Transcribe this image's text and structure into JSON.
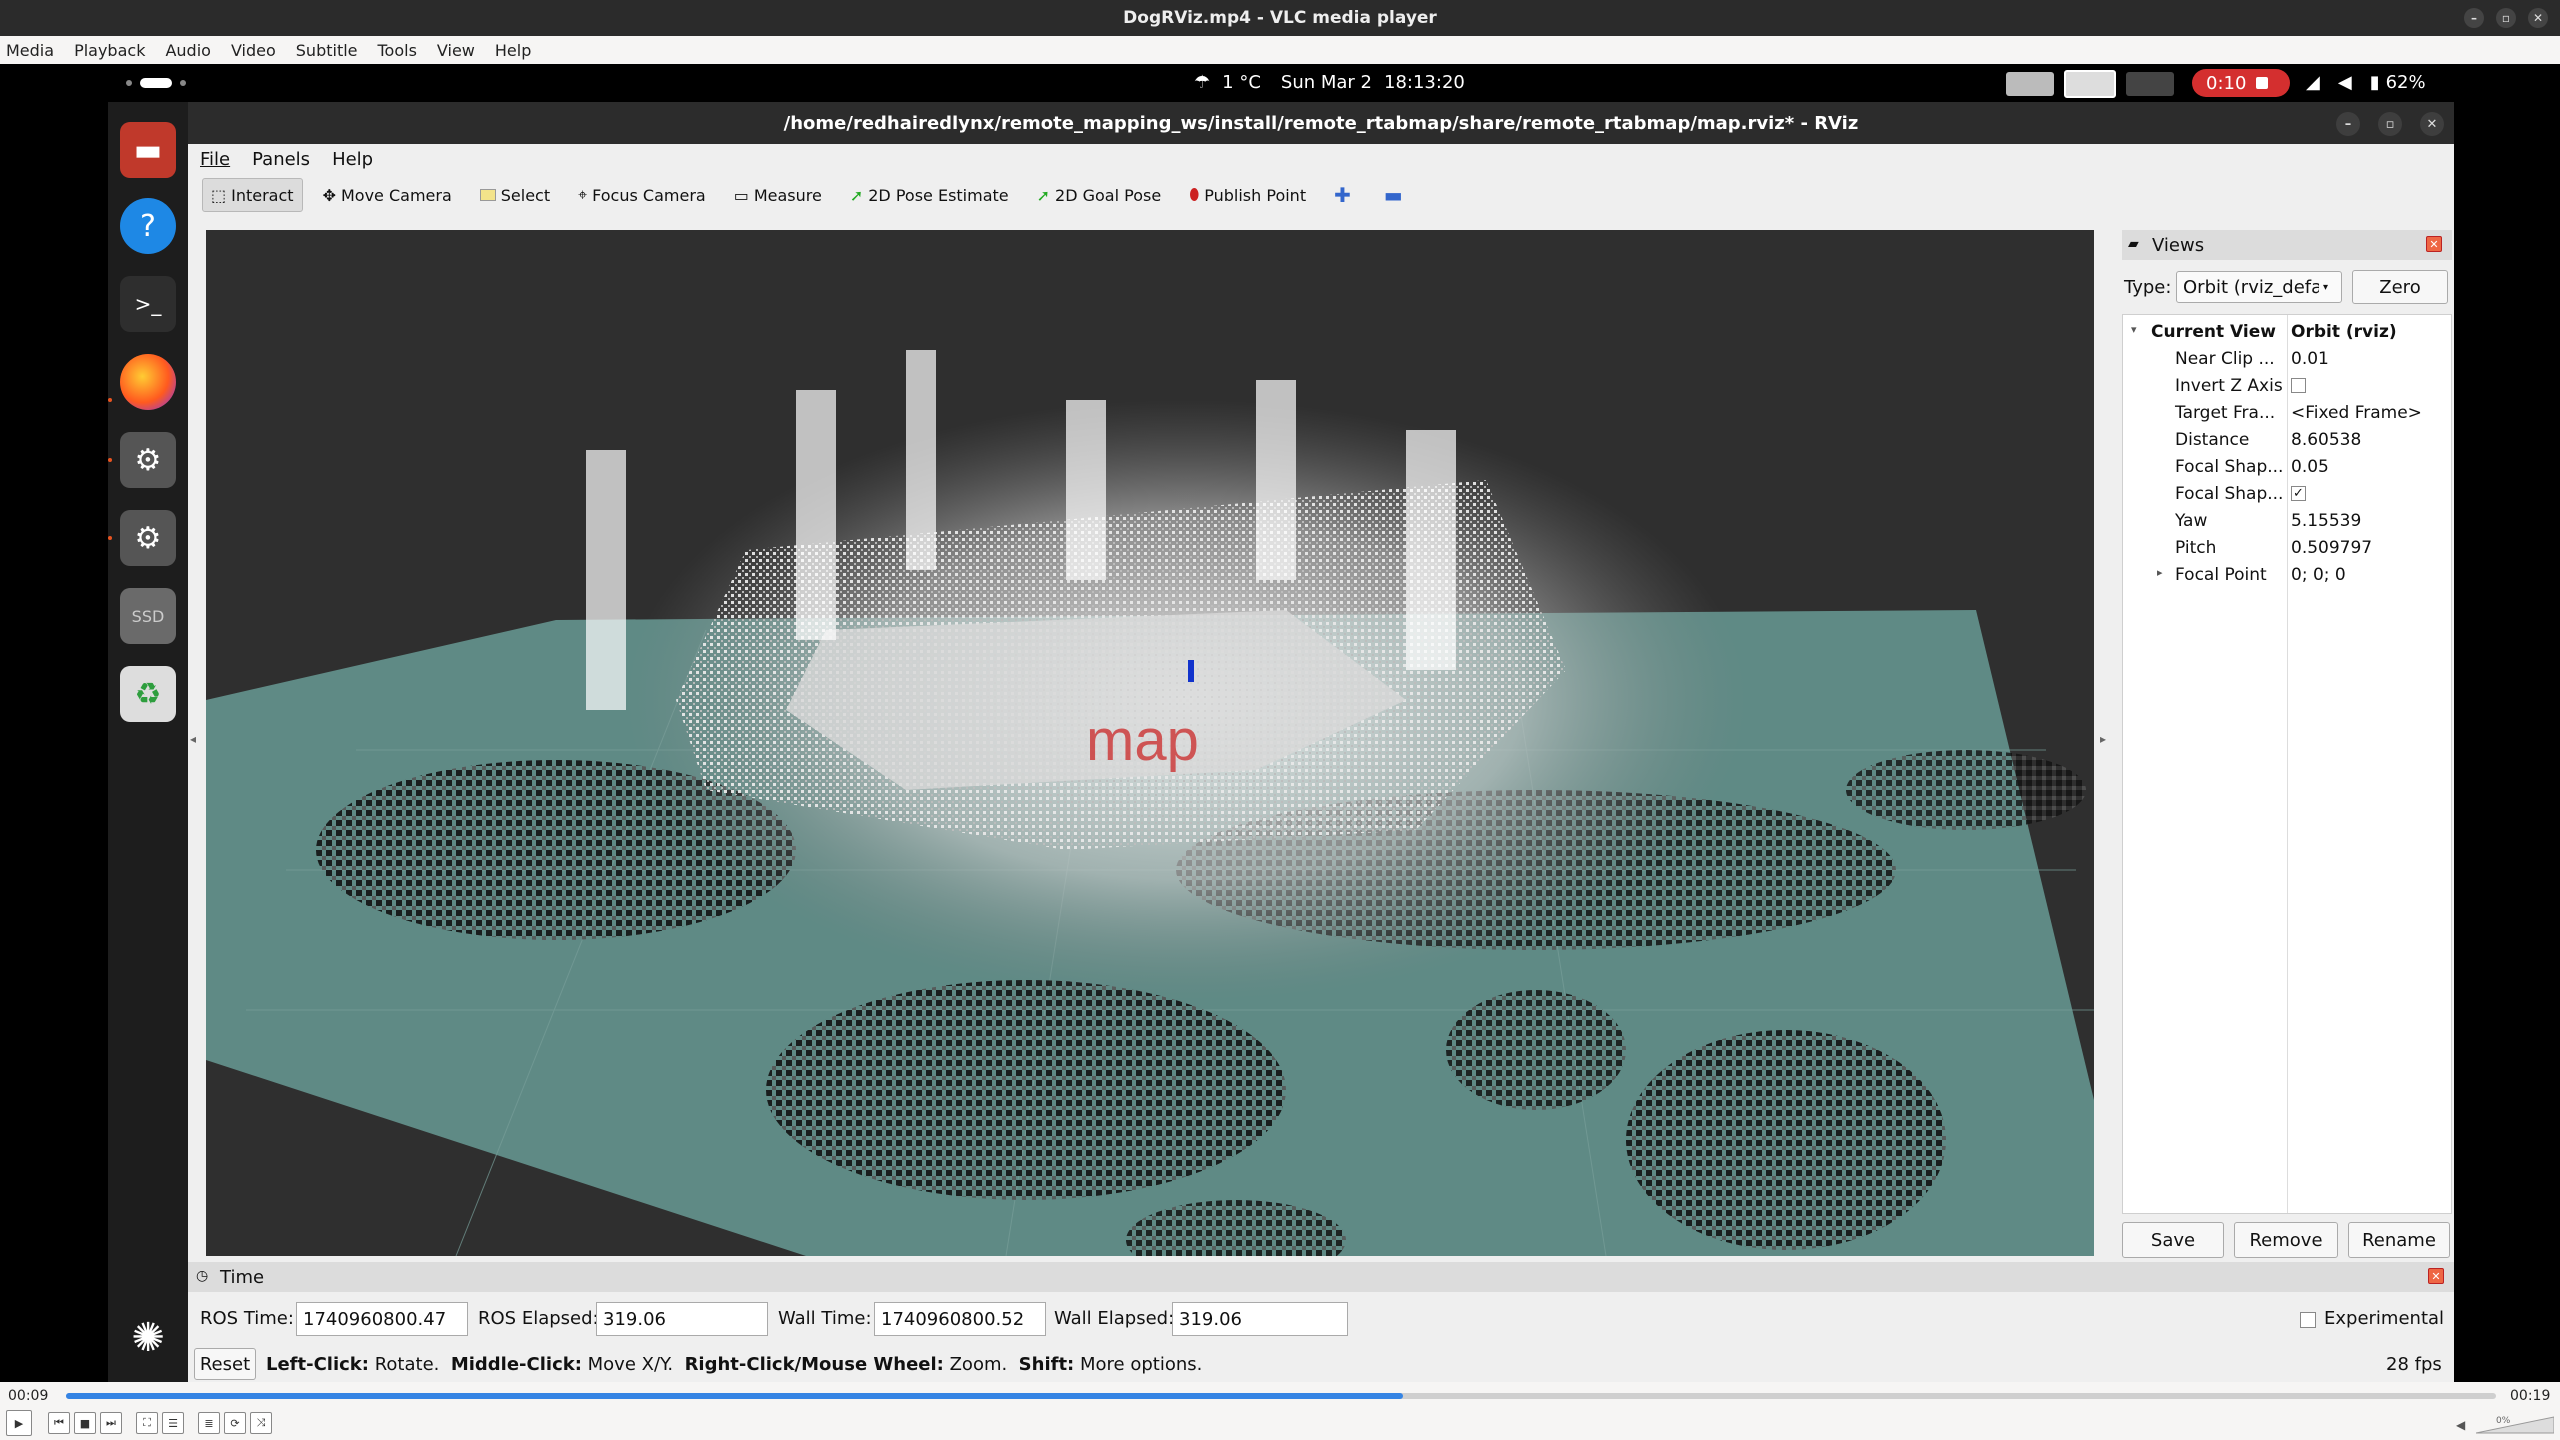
{
  "vlc": {
    "title": "DogRViz.mp4 - VLC media player",
    "menu": [
      "Media",
      "Playback",
      "Audio",
      "Video",
      "Subtitle",
      "Tools",
      "View",
      "Help"
    ],
    "time_elapsed": "00:09",
    "time_total": "00:19",
    "progress_fraction": 0.55,
    "volume_label": "0%"
  },
  "topbar": {
    "weather": "1 °C",
    "date": "Sun Mar 2",
    "time": "18:13:20",
    "recording": "0:10",
    "battery": "62%"
  },
  "dock": {
    "icons": [
      "files-icon",
      "help-icon",
      "terminal-icon",
      "firefox-icon",
      "settings-icon",
      "settings-icon-2",
      "ssd-drive-icon",
      "trash-icon",
      "app-grid-icon"
    ],
    "ssd_label": "SSD"
  },
  "rviz": {
    "title": "/home/redhairedlynx/remote_mapping_ws/install/remote_rtabmap/share/remote_rtabmap/map.rviz* - RViz",
    "menu": [
      "File",
      "Panels",
      "Help"
    ],
    "tools": [
      {
        "label": "Interact",
        "active": true
      },
      {
        "label": "Move Camera"
      },
      {
        "label": "Select"
      },
      {
        "label": "Focus Camera"
      },
      {
        "label": "Measure"
      },
      {
        "label": "2D Pose Estimate"
      },
      {
        "label": "2D Goal Pose"
      },
      {
        "label": "Publish Point"
      }
    ],
    "viewport_text": "map"
  },
  "views_panel": {
    "title": "Views",
    "type_label": "Type:",
    "type_value": "Orbit (rviz_defau",
    "zero_label": "Zero",
    "current_view_label": "Current View",
    "current_view_value": "Orbit (rviz)",
    "properties": [
      {
        "name": "Near Clip ...",
        "value": "0.01"
      },
      {
        "name": "Invert Z Axis",
        "value": "",
        "checkbox": false
      },
      {
        "name": "Target Fra...",
        "value": "<Fixed Frame>"
      },
      {
        "name": "Distance",
        "value": "8.60538"
      },
      {
        "name": "Focal Shap...",
        "value": "0.05"
      },
      {
        "name": "Focal Shap...",
        "value": "",
        "checkbox": true
      },
      {
        "name": "Yaw",
        "value": "5.15539"
      },
      {
        "name": "Pitch",
        "value": "0.509797"
      },
      {
        "name": "Focal Point",
        "value": "0; 0; 0"
      }
    ],
    "buttons": [
      "Save",
      "Remove",
      "Rename"
    ]
  },
  "time_panel": {
    "title": "Time",
    "ros_time_label": "ROS Time:",
    "ros_time": "1740960800.47",
    "ros_elapsed_label": "ROS Elapsed:",
    "ros_elapsed": "319.06",
    "wall_time_label": "Wall Time:",
    "wall_time": "1740960800.52",
    "wall_elapsed_label": "Wall Elapsed:",
    "wall_elapsed": "319.06",
    "experimental_label": "Experimental",
    "reset_label": "Reset",
    "hint_parts": [
      {
        "bold": "Left-Click:",
        "text": " Rotate. "
      },
      {
        "bold": "Middle-Click:",
        "text": " Move X/Y. "
      },
      {
        "bold": "Right-Click/Mouse Wheel:",
        "text": " Zoom. "
      },
      {
        "bold": "Shift:",
        "text": " More options."
      }
    ],
    "fps": "28 fps"
  }
}
